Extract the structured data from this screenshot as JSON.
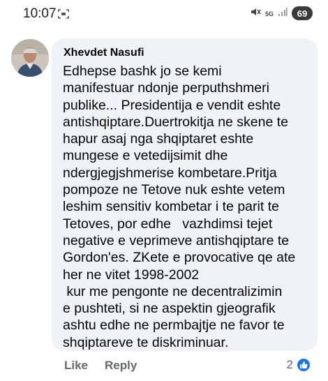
{
  "status_bar": {
    "time": "10:07",
    "network_label": "5G",
    "battery": "69"
  },
  "comment": {
    "author": "Xhevdet Nasufi",
    "lines": [
      "Edhepse bashk jo se kemi",
      "manifestuar ndonje perputhshmeri",
      "publike... Presidentija e vendit eshte",
      "antishqiptare.Duertrokitja ne skene te",
      "hapur asaj nga shqiptaret eshte",
      "mungese e vetedijsimit dhe",
      "ndergjegjshmerise kombetare.Pritja",
      "pompoze ne Tetove nuk eshte vetem",
      "leshim sensitiv kombetar i te parit te",
      "Tetoves, por edhe   vazhdimsi tejet",
      "negative e veprimeve antishqiptare te",
      "Gordon'es. ZKete e provocative qe ate",
      "her ne vitet 1998-2002",
      " kur me pengonte ne decentralizimin",
      "e pushteti, si ne aspektin gjeografik",
      "ashtu edhe ne permbajtje ne favor te",
      "shqiptareve te diskriminuar."
    ],
    "actions": {
      "like_label": "Like",
      "reply_label": "Reply"
    },
    "reaction_count": "2"
  }
}
